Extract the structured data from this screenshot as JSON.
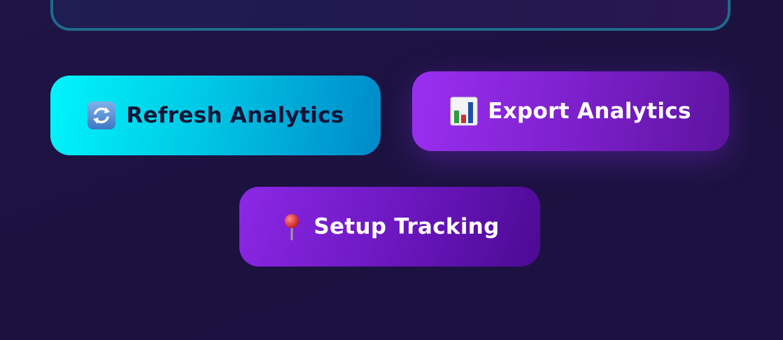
{
  "buttons": {
    "refresh": {
      "label": "Refresh Analytics",
      "icon": "refresh-icon"
    },
    "export": {
      "label": "Export Analytics",
      "icon": "bar-chart-icon"
    },
    "setup": {
      "label": "Setup Tracking",
      "icon": "pushpin-icon"
    }
  },
  "colors": {
    "background": "#1c1240",
    "refresh_start": "#00f5fb",
    "refresh_end": "#0089c9",
    "export_start": "#9b2ff2",
    "export_end": "#5d139f",
    "setup_start": "#8c28e6",
    "setup_end": "#4b0a93",
    "panel_border": "#1f6b8a"
  }
}
